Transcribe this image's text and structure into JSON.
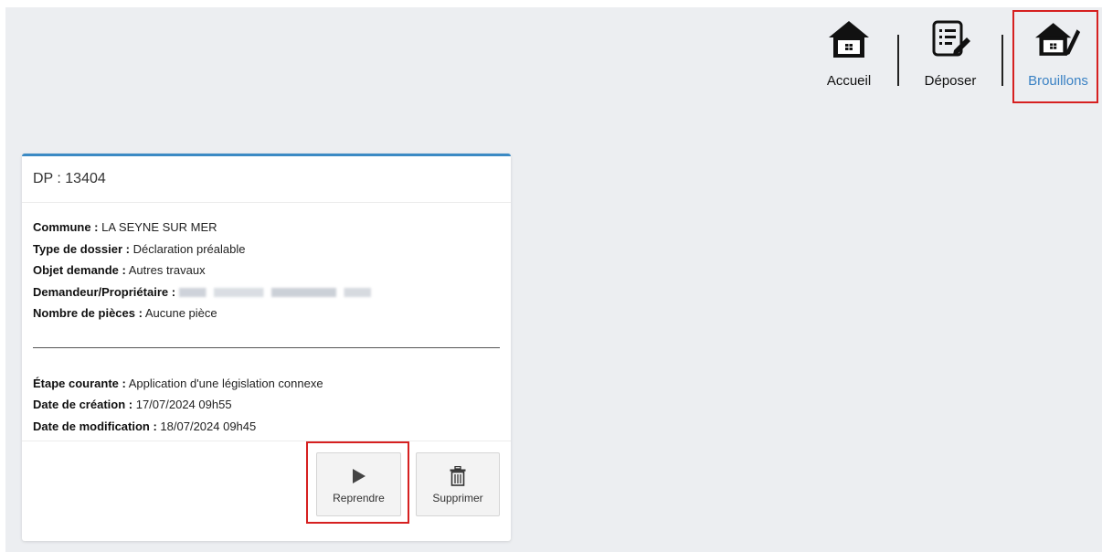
{
  "nav": {
    "items": [
      {
        "label": "Accueil",
        "icon": "house-icon",
        "active": false
      },
      {
        "label": "Déposer",
        "icon": "document-edit-icon",
        "active": false
      },
      {
        "label": "Brouillons",
        "icon": "house-pen-icon",
        "active": true
      }
    ]
  },
  "card": {
    "title": "DP : 13404",
    "fields": [
      {
        "key": "Commune :",
        "value": "LA SEYNE SUR MER"
      },
      {
        "key": "Type de dossier :",
        "value": "Déclaration préalable"
      },
      {
        "key": "Objet demande :",
        "value": "Autres travaux"
      },
      {
        "key": "Demandeur/Propriétaire :",
        "value": ""
      },
      {
        "key": "Nombre de pièces :",
        "value": "Aucune pièce"
      }
    ],
    "meta": [
      {
        "key": "Étape courante :",
        "value": "Application d'une législation connexe"
      },
      {
        "key": "Date de création :",
        "value": "17/07/2024 09h55"
      },
      {
        "key": "Date de modification :",
        "value": "18/07/2024 09h45"
      }
    ],
    "actions": {
      "resume_label": "Reprendre",
      "resume_icon": "play-icon",
      "delete_label": "Supprimer",
      "delete_icon": "trash-icon"
    }
  },
  "colors": {
    "accent": "#3b8ac4",
    "active_nav": "#3b82c4",
    "highlight": "#d62020",
    "background": "#eceef1"
  }
}
